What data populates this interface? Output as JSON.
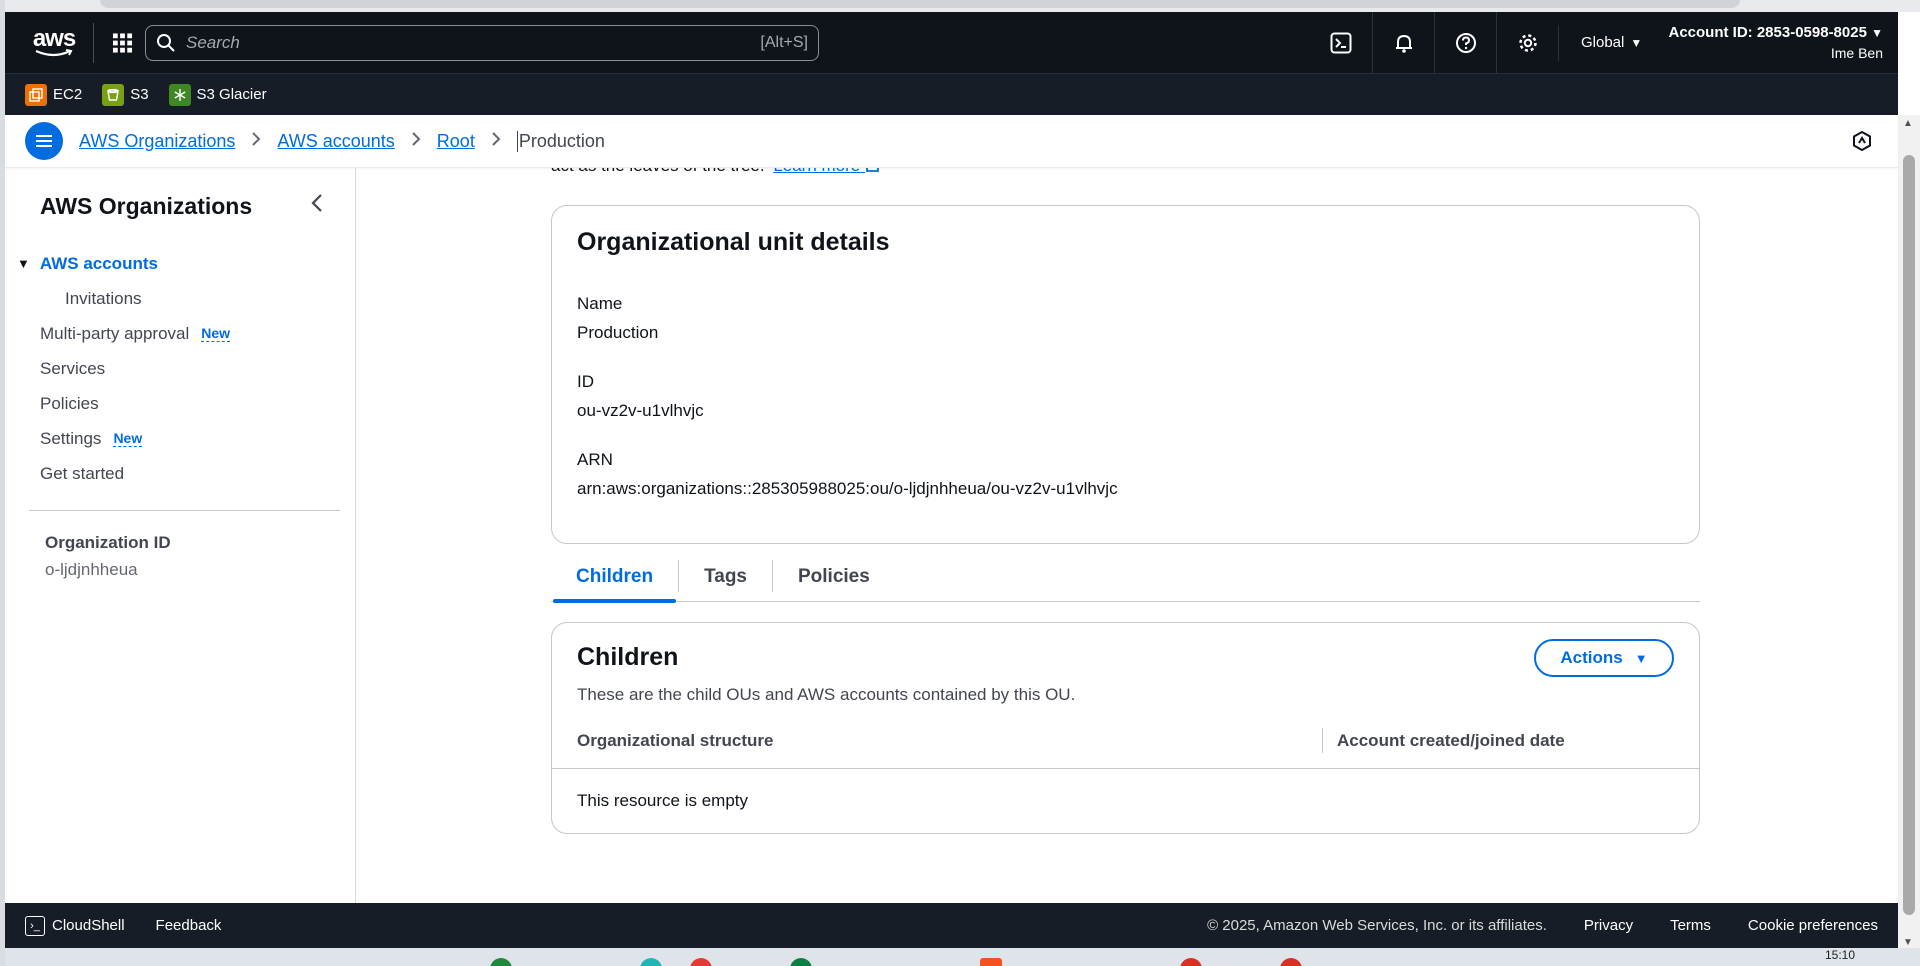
{
  "topnav": {
    "logo_text": "aws",
    "search_placeholder": "Search",
    "search_shortcut": "[Alt+S]",
    "region": "Global",
    "account_id": "Account ID: 2853-0598-8025",
    "user": "Ime Ben"
  },
  "favorites": [
    {
      "label": "EC2",
      "color": "#ed7100"
    },
    {
      "label": "S3",
      "color": "#7aa116"
    },
    {
      "label": "S3 Glacier",
      "color": "#3f8624"
    }
  ],
  "breadcrumb": {
    "items": [
      "AWS Organizations",
      "AWS accounts",
      "Root"
    ],
    "current": "Production"
  },
  "sidebar": {
    "title": "AWS Organizations",
    "items": [
      {
        "label": "AWS accounts"
      },
      {
        "label": "Invitations"
      },
      {
        "label": "Multi-party approval",
        "badge": "New"
      },
      {
        "label": "Services"
      },
      {
        "label": "Policies"
      },
      {
        "label": "Settings",
        "badge": "New"
      },
      {
        "label": "Get started"
      }
    ],
    "org_label": "Organization ID",
    "org_value": "o-ljdjnhheua"
  },
  "main": {
    "partial_text": "act as the leaves of the tree.",
    "learn_more": "Learn more",
    "details": {
      "title": "Organizational unit details",
      "name_label": "Name",
      "name_value": "Production",
      "id_label": "ID",
      "id_value": "ou-vz2v-u1vlhvjc",
      "arn_label": "ARN",
      "arn_value": "arn:aws:organizations::285305988025:ou/o-ljdjnhheua/ou-vz2v-u1vlhvjc"
    },
    "tabs": [
      "Children",
      "Tags",
      "Policies"
    ],
    "children": {
      "title": "Children",
      "description": "These are the child OUs and AWS accounts contained by this OU.",
      "actions_label": "Actions",
      "col1": "Organizational structure",
      "col2": "Account created/joined date",
      "empty": "This resource is empty"
    }
  },
  "footer": {
    "cloudshell": "CloudShell",
    "feedback": "Feedback",
    "copyright": "© 2025, Amazon Web Services, Inc. or its affiliates.",
    "privacy": "Privacy",
    "terms": "Terms",
    "cookies": "Cookie preferences"
  },
  "taskbar": {
    "time": "15:10"
  },
  "colors": {
    "accent": "#006ce0",
    "nav_bg": "#0f141a",
    "footer_bg": "#161d26"
  }
}
